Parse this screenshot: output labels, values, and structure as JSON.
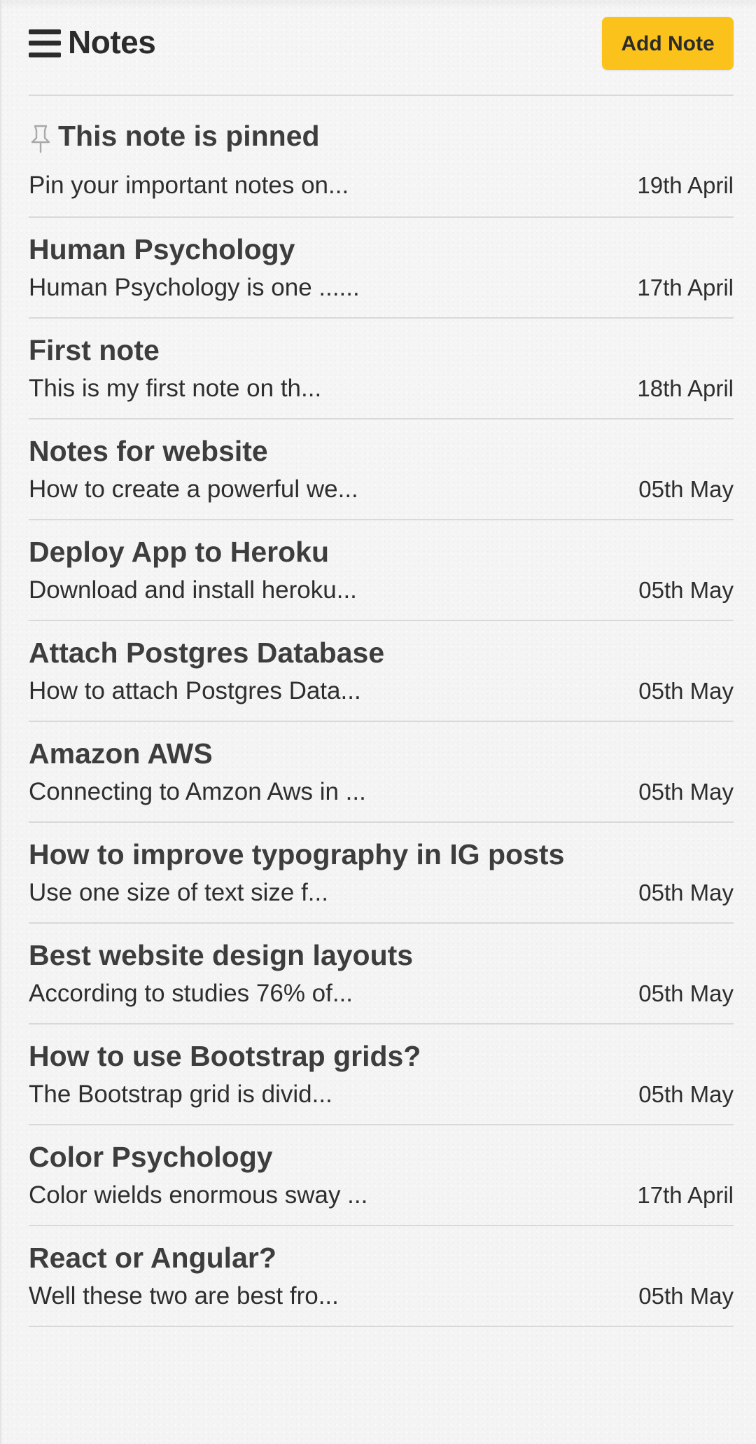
{
  "header": {
    "title": "Notes",
    "add_button_label": "Add Note"
  },
  "colors": {
    "accent": "#fbc21b",
    "text": "#3d3d3d",
    "divider": "#d9d9d9"
  },
  "icons": {
    "menu": "hamburger-menu-icon",
    "pin": "pin-icon"
  },
  "notes": [
    {
      "title": "This note is pinned",
      "excerpt": "Pin your important notes on...",
      "date": "19th April",
      "pinned": true
    },
    {
      "title": "Human Psychology",
      "excerpt": "Human Psychology is one ......",
      "date": "17th April"
    },
    {
      "title": "First note",
      "excerpt": "This is my first note on th...",
      "date": "18th April"
    },
    {
      "title": "Notes for website",
      "excerpt": "How to create a powerful we...",
      "date": "05th May"
    },
    {
      "title": "Deploy App to Heroku",
      "excerpt": "Download and install heroku...",
      "date": "05th May"
    },
    {
      "title": "Attach Postgres Database",
      "excerpt": "How to attach Postgres Data...",
      "date": "05th May"
    },
    {
      "title": "Amazon AWS",
      "excerpt": "Connecting to Amzon Aws in ...",
      "date": "05th May"
    },
    {
      "title": "How to improve typography in IG posts",
      "excerpt": "Use one size of text size f...",
      "date": "05th May"
    },
    {
      "title": "Best website design layouts",
      "excerpt": "According to studies 76% of...",
      "date": "05th May"
    },
    {
      "title": "How to use Bootstrap grids?",
      "excerpt": "The Bootstrap grid is divid...",
      "date": "05th May"
    },
    {
      "title": "Color Psychology",
      "excerpt": "Color wields enormous sway ...",
      "date": "17th April"
    },
    {
      "title": "React or Angular?",
      "excerpt": "Well these two are best fro...",
      "date": "05th May"
    }
  ]
}
